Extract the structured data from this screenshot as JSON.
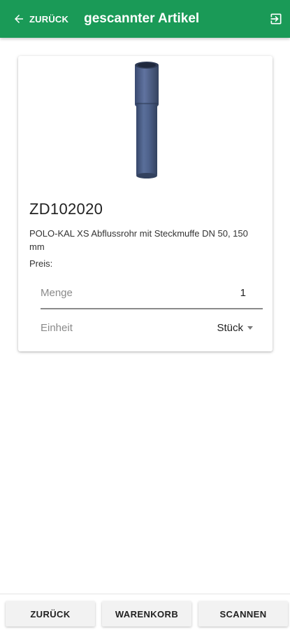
{
  "header": {
    "back_label": "ZURÜCK",
    "title": "gescannter Artikel",
    "logout_icon": "logout-icon",
    "back_icon": "arrow-left-icon"
  },
  "product": {
    "image_icon": "pipe-image",
    "article_number": "ZD102020",
    "description": "POLO-KAL XS Abflussrohr mit Steckmuffe DN 50, 150 mm",
    "price_label": "Preis:",
    "quantity_label": "Menge",
    "quantity_value": "1",
    "unit_label": "Einheit",
    "unit_value": "Stück"
  },
  "footer": {
    "back_button": "ZURÜCK",
    "cart_button": "WARENKORB",
    "scan_button": "SCANNEN"
  },
  "colors": {
    "primary": "#1a9a57",
    "pipe": "#4b5f88"
  }
}
